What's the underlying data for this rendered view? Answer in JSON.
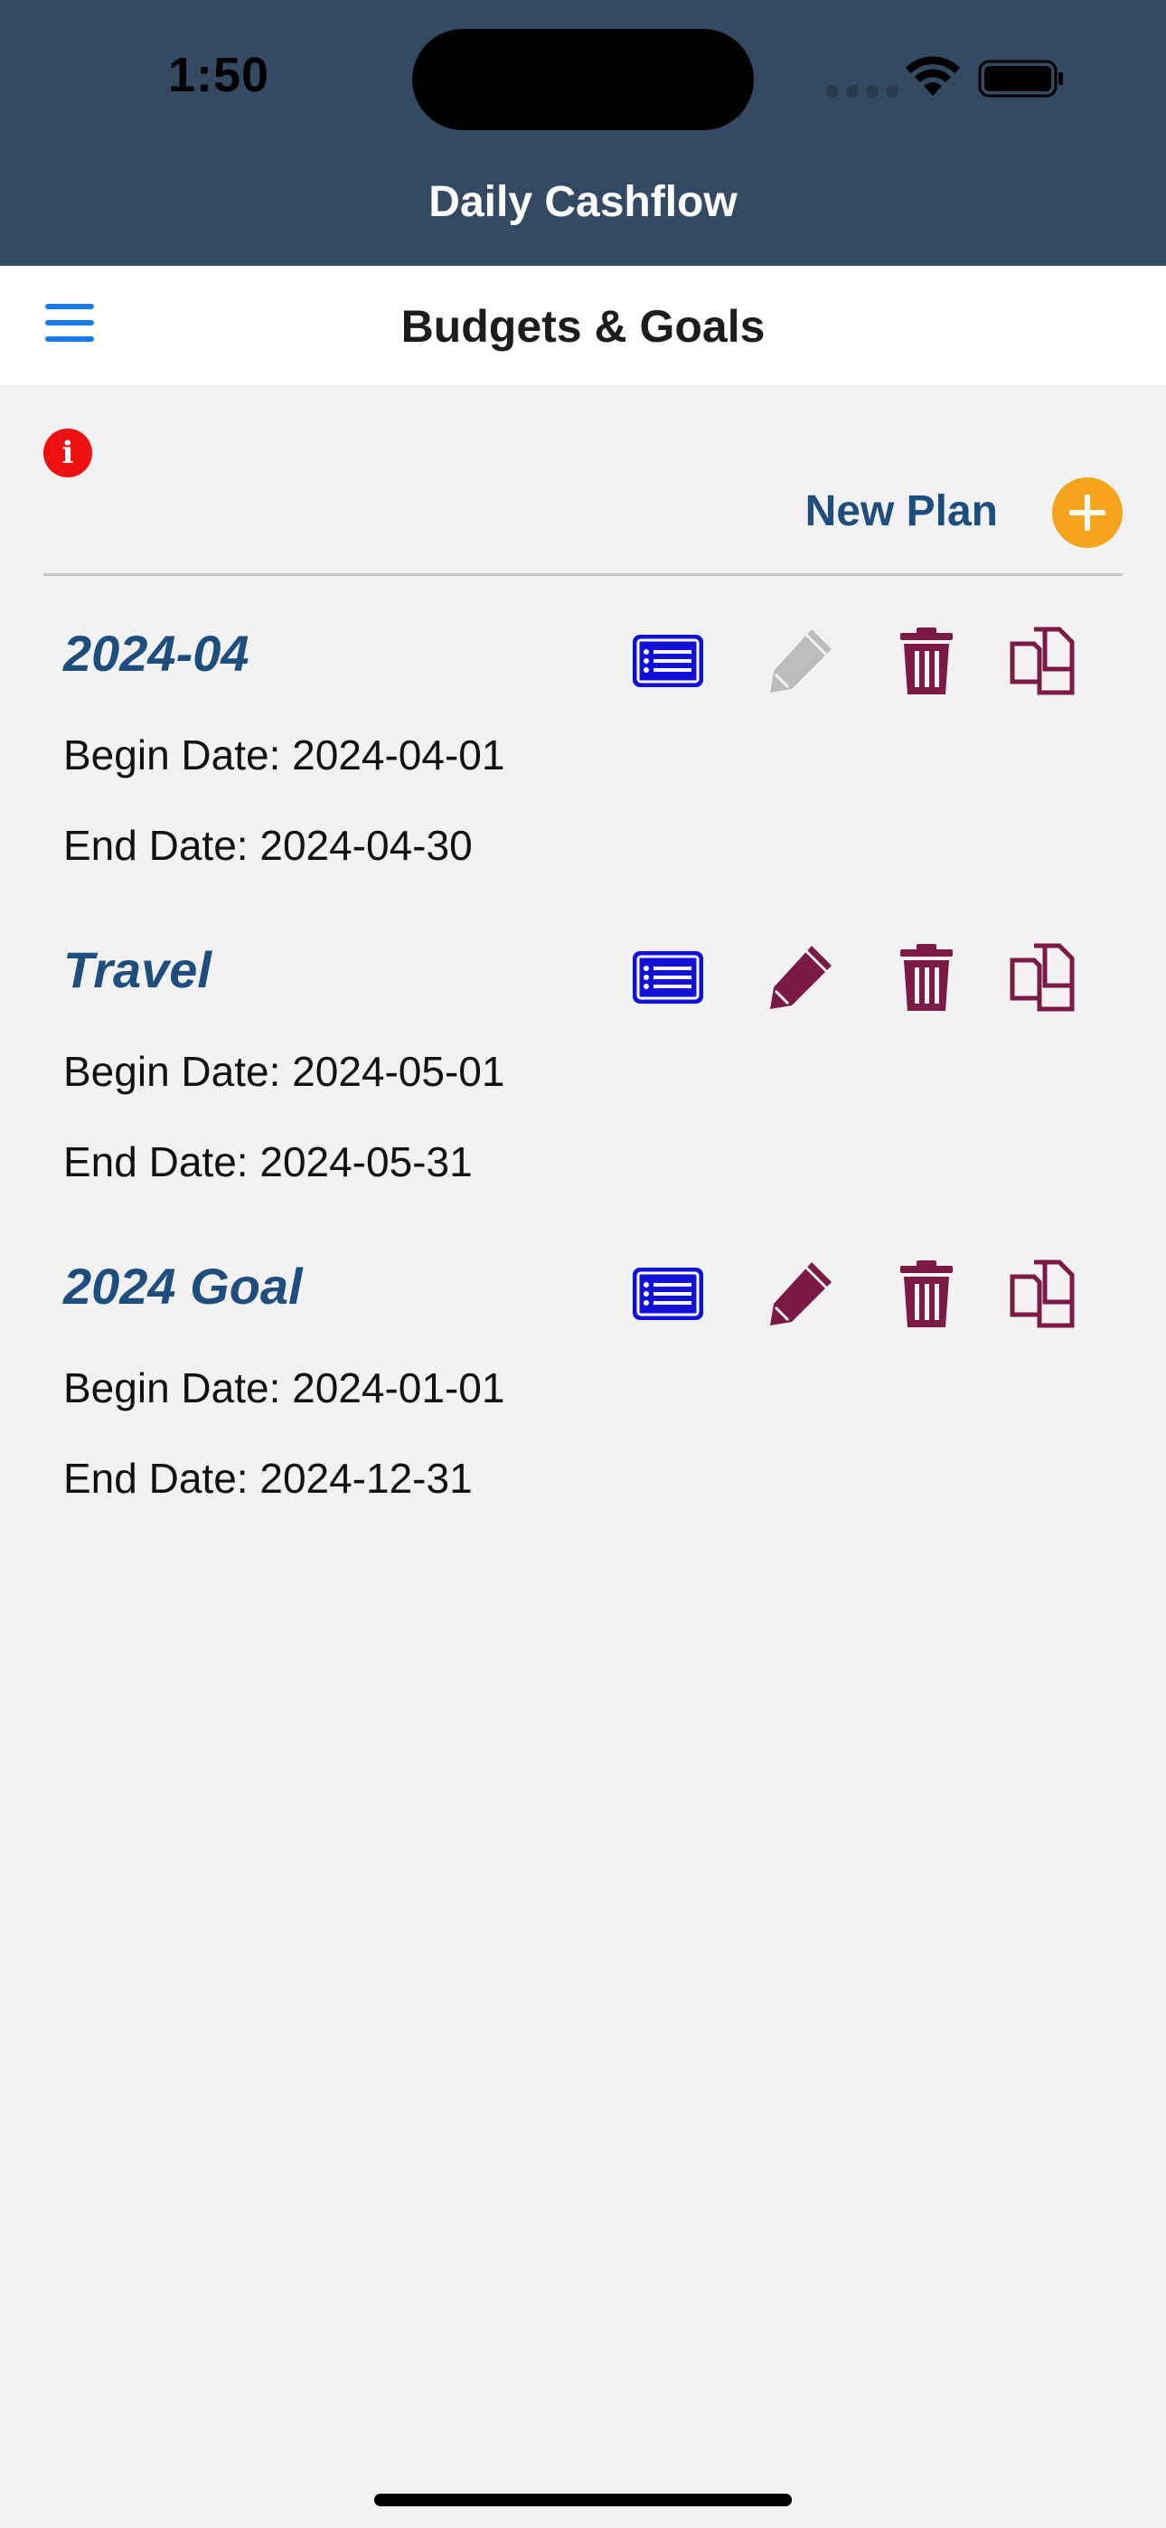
{
  "status_bar": {
    "time": "1:50"
  },
  "header": {
    "app_title": "Daily Cashflow",
    "color": "#344a63"
  },
  "nav": {
    "page_title": "Budgets & Goals",
    "menu_icon": "hamburger-menu-icon"
  },
  "toolbar": {
    "info_badge": "i",
    "new_plan_label": "New Plan",
    "add_icon": "plus-circle-icon",
    "accent_color": "#f7a41d"
  },
  "plans": [
    {
      "name": "2024-04",
      "begin": "Begin Date: 2024-04-01",
      "end": "End Date: 2024-04-30",
      "edit_enabled": false
    },
    {
      "name": "Travel",
      "begin": "Begin Date: 2024-05-01",
      "end": "End Date: 2024-05-31",
      "edit_enabled": true
    },
    {
      "name": "2024 Goal",
      "begin": "Begin Date: 2024-01-01",
      "end": "End Date: 2024-12-31",
      "edit_enabled": true
    }
  ],
  "colors": {
    "plan_name": "#1e4e7e",
    "list_icon": "#1010d8",
    "action_icon": "#7a1a45",
    "disabled_icon": "#bdbdbd"
  }
}
